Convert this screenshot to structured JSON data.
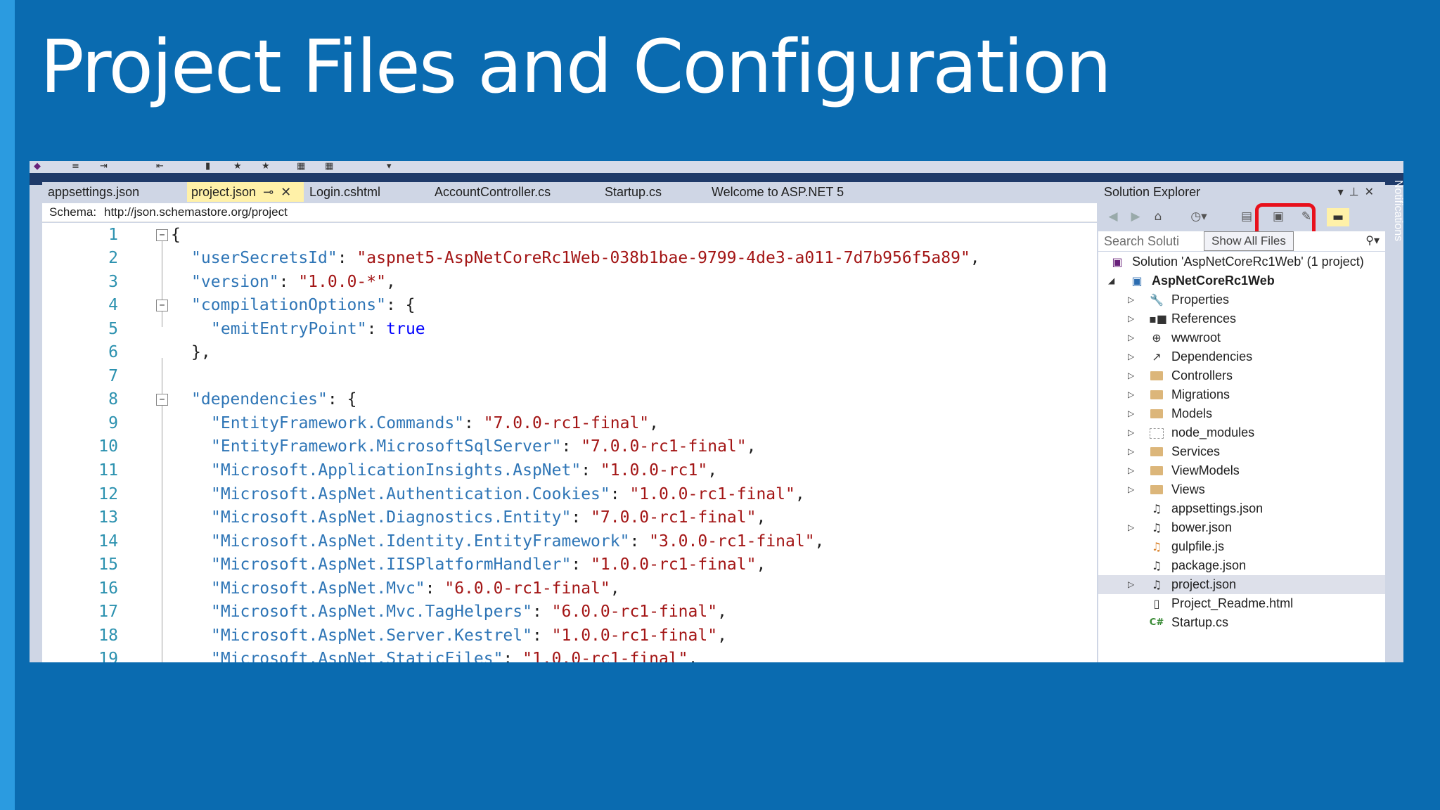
{
  "slide": {
    "title": "Project Files and Configuration"
  },
  "tabs": [
    {
      "label": "appsettings.json",
      "active": false
    },
    {
      "label": "project.json",
      "active": true
    },
    {
      "label": "Login.cshtml",
      "active": false
    },
    {
      "label": "AccountController.cs",
      "active": false
    },
    {
      "label": "Startup.cs",
      "active": false
    },
    {
      "label": "Welcome to ASP.NET 5",
      "active": false
    }
  ],
  "schema": {
    "label": "Schema:",
    "url": "http://json.schemastore.org/project"
  },
  "editor": {
    "lines": [
      {
        "n": "1"
      },
      {
        "n": "2"
      },
      {
        "n": "3"
      },
      {
        "n": "4"
      },
      {
        "n": "5"
      },
      {
        "n": "6"
      },
      {
        "n": "7"
      },
      {
        "n": "8"
      },
      {
        "n": "9"
      },
      {
        "n": "10"
      },
      {
        "n": "11"
      },
      {
        "n": "12"
      },
      {
        "n": "13"
      },
      {
        "n": "14"
      },
      {
        "n": "15"
      },
      {
        "n": "16"
      },
      {
        "n": "17"
      },
      {
        "n": "18"
      },
      {
        "n": "19"
      }
    ],
    "json": {
      "userSecretsId_key": "\"userSecretsId\"",
      "userSecretsId_val": "\"aspnet5-AspNetCoreRc1Web-038b1bae-9799-4de3-a011-7d7b956f5a89\"",
      "version_key": "\"version\"",
      "version_val": "\"1.0.0-*\"",
      "compilationOptions_key": "\"compilationOptions\"",
      "emitEntryPoint_key": "\"emitEntryPoint\"",
      "emitEntryPoint_val": "true",
      "dependencies_key": "\"dependencies\"",
      "deps": [
        {
          "k": "\"EntityFramework.Commands\"",
          "v": "\"7.0.0-rc1-final\""
        },
        {
          "k": "\"EntityFramework.MicrosoftSqlServer\"",
          "v": "\"7.0.0-rc1-final\""
        },
        {
          "k": "\"Microsoft.ApplicationInsights.AspNet\"",
          "v": "\"1.0.0-rc1\""
        },
        {
          "k": "\"Microsoft.AspNet.Authentication.Cookies\"",
          "v": "\"1.0.0-rc1-final\""
        },
        {
          "k": "\"Microsoft.AspNet.Diagnostics.Entity\"",
          "v": "\"7.0.0-rc1-final\""
        },
        {
          "k": "\"Microsoft.AspNet.Identity.EntityFramework\"",
          "v": "\"3.0.0-rc1-final\""
        },
        {
          "k": "\"Microsoft.AspNet.IISPlatformHandler\"",
          "v": "\"1.0.0-rc1-final\""
        },
        {
          "k": "\"Microsoft.AspNet.Mvc\"",
          "v": "\"6.0.0-rc1-final\""
        },
        {
          "k": "\"Microsoft.AspNet.Mvc.TagHelpers\"",
          "v": "\"6.0.0-rc1-final\""
        },
        {
          "k": "\"Microsoft.AspNet.Server.Kestrel\"",
          "v": "\"1.0.0-rc1-final\""
        },
        {
          "k": "\"Microsoft.AspNet.StaticFiles\"",
          "v": "\"1.0.0-rc1-final\""
        }
      ]
    }
  },
  "solution_explorer": {
    "title": "Solution Explorer",
    "search_placeholder": "Search Soluti",
    "tooltip": "Show All Files",
    "solution_label": "Solution 'AspNetCoreRc1Web' (1 project)",
    "project_label": "AspNetCoreRc1Web",
    "items": [
      {
        "label": "Properties",
        "icon": "wrench-icon"
      },
      {
        "label": "References",
        "icon": "references-icon"
      },
      {
        "label": "wwwroot",
        "icon": "globe-icon"
      },
      {
        "label": "Dependencies",
        "icon": "dependencies-icon"
      },
      {
        "label": "Controllers",
        "icon": "folder-icon"
      },
      {
        "label": "Migrations",
        "icon": "folder-icon"
      },
      {
        "label": "Models",
        "icon": "folder-icon"
      },
      {
        "label": "node_modules",
        "icon": "folder-outline-icon"
      },
      {
        "label": "Services",
        "icon": "folder-icon"
      },
      {
        "label": "ViewModels",
        "icon": "folder-icon"
      },
      {
        "label": "Views",
        "icon": "folder-icon"
      },
      {
        "label": "appsettings.json",
        "icon": "json-file-icon"
      },
      {
        "label": "bower.json",
        "icon": "json-file-icon"
      },
      {
        "label": "gulpfile.js",
        "icon": "js-file-icon"
      },
      {
        "label": "package.json",
        "icon": "json-file-icon"
      },
      {
        "label": "project.json",
        "icon": "json-file-icon",
        "selected": true
      },
      {
        "label": "Project_Readme.html",
        "icon": "html-file-icon"
      },
      {
        "label": "Startup.cs",
        "icon": "csharp-file-icon"
      }
    ]
  },
  "notifications_label": "Notifications",
  "colors": {
    "slide_bg": "#0a6bb0",
    "slide_stripe": "#2b9be0",
    "highlight": "#e8101b",
    "active_tab": "#fff1a8",
    "json_key": "#2e75b6",
    "json_string": "#a31515",
    "json_keyword": "#0000ff",
    "line_number": "#2b91af"
  }
}
